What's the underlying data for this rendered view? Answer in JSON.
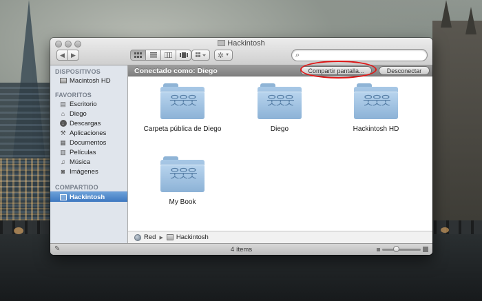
{
  "window": {
    "title": "Hackintosh"
  },
  "toolbar": {
    "back_icon": "chevron-left-icon",
    "forward_icon": "chevron-right-icon",
    "view_modes": [
      "icon-view",
      "list-view",
      "column-view",
      "cover-flow-view"
    ],
    "active_view": "icon-view",
    "arrange_icon": "arrange-icon",
    "action_icon": "gear-icon",
    "search": {
      "placeholder": "",
      "value": ""
    }
  },
  "sidebar": {
    "sections": [
      {
        "heading": "DISPOSITIVOS",
        "items": [
          {
            "label": "Macintosh HD",
            "icon": "hard-drive-icon"
          }
        ]
      },
      {
        "heading": "FAVORITOS",
        "items": [
          {
            "label": "Escritorio",
            "icon": "desktop-icon"
          },
          {
            "label": "Diego",
            "icon": "home-icon"
          },
          {
            "label": "Descargas",
            "icon": "downloads-icon"
          },
          {
            "label": "Aplicaciones",
            "icon": "applications-icon"
          },
          {
            "label": "Documentos",
            "icon": "documents-icon"
          },
          {
            "label": "Películas",
            "icon": "movies-icon"
          },
          {
            "label": "Música",
            "icon": "music-icon"
          },
          {
            "label": "Imágenes",
            "icon": "pictures-icon"
          }
        ]
      },
      {
        "heading": "COMPARTIDO",
        "items": [
          {
            "label": "Hackintosh",
            "icon": "shared-computer-icon",
            "selected": true
          }
        ]
      }
    ]
  },
  "connection": {
    "label": "Conectado como: Diego",
    "share_screen_label": "Compartir pantalla...",
    "disconnect_label": "Desconectar"
  },
  "content": {
    "items": [
      {
        "label": "Carpeta pública de Diego",
        "icon": "shared-folder-icon"
      },
      {
        "label": "Diego",
        "icon": "shared-folder-icon"
      },
      {
        "label": "Hackintosh HD",
        "icon": "shared-folder-icon"
      },
      {
        "label": "My Book",
        "icon": "shared-folder-icon"
      }
    ]
  },
  "pathbar": {
    "segments": [
      {
        "label": "Red",
        "icon": "network-icon"
      },
      {
        "label": "Hackintosh",
        "icon": "server-icon"
      }
    ]
  },
  "status": {
    "text": "4 ítems"
  },
  "colors": {
    "highlight": "#e01818",
    "selection": "#3e78c0",
    "folder": "#8cb2d6"
  }
}
